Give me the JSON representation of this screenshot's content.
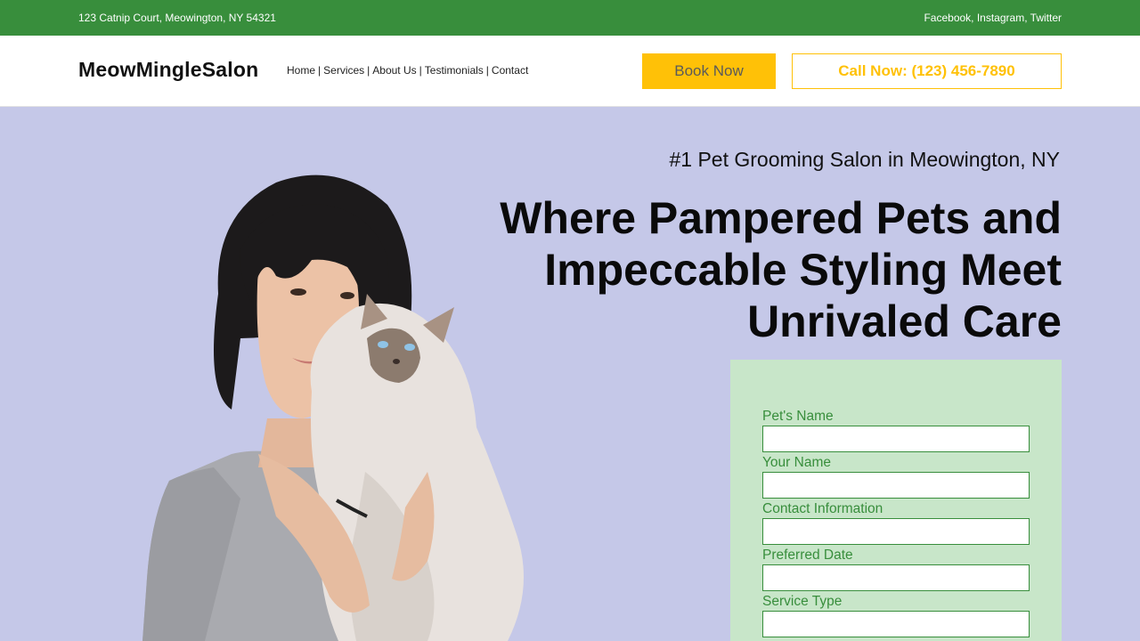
{
  "topbar": {
    "address": "123 Catnip Court, Meowington, NY 54321",
    "social_links": [
      "Facebook",
      "Instagram",
      "Twitter"
    ]
  },
  "header": {
    "logo": "MeowMingleSalon",
    "nav": [
      "Home",
      "Services",
      "About Us",
      "Testimonials",
      "Contact"
    ],
    "book_label": "Book Now",
    "call_label": "Call Now: (123) 456-7890"
  },
  "hero": {
    "tagline": "#1 Pet Grooming Salon in Meowington, NY",
    "headline": "Where Pampered Pets and Impeccable Styling Meet Unrivaled Care",
    "image_alt": "woman-holding-fluffy-cat"
  },
  "form": {
    "fields": [
      {
        "label": "Pet's Name",
        "value": ""
      },
      {
        "label": "Your Name",
        "value": ""
      },
      {
        "label": "Contact Information",
        "value": ""
      },
      {
        "label": "Preferred Date",
        "value": ""
      },
      {
        "label": "Service Type",
        "value": ""
      }
    ]
  },
  "colors": {
    "brand_green": "#388e3c",
    "accent_yellow": "#ffc107",
    "hero_bg": "#c5c8e8",
    "form_bg": "#c8e6c9"
  }
}
